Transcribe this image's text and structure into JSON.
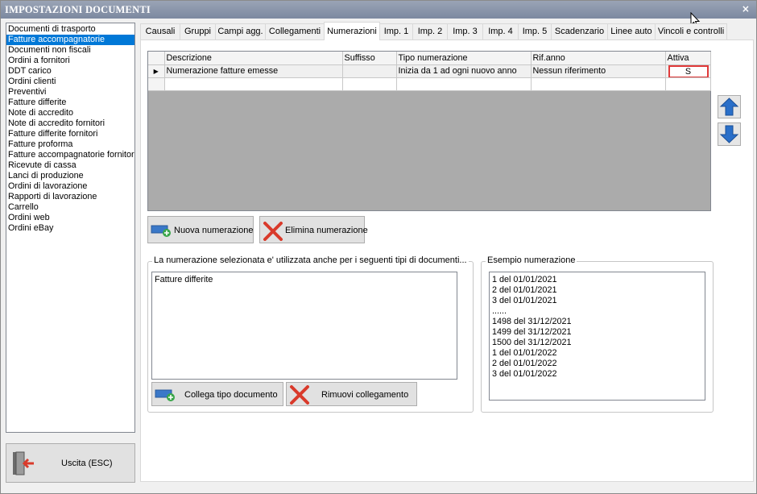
{
  "window": {
    "title": "IMPOSTAZIONI DOCUMENTI",
    "close_label": "×"
  },
  "doc_types": [
    {
      "label": "Documenti di trasporto",
      "selected": false
    },
    {
      "label": "Fatture accompagnatorie",
      "selected": true
    },
    {
      "label": "Documenti non fiscali",
      "selected": false
    },
    {
      "label": "Ordini a fornitori",
      "selected": false
    },
    {
      "label": "DDT carico",
      "selected": false
    },
    {
      "label": "Ordini clienti",
      "selected": false
    },
    {
      "label": "Preventivi",
      "selected": false
    },
    {
      "label": "Fatture differite",
      "selected": false
    },
    {
      "label": "Note di accredito",
      "selected": false
    },
    {
      "label": "Note di accredito fornitori",
      "selected": false
    },
    {
      "label": "Fatture differite fornitori",
      "selected": false
    },
    {
      "label": "Fatture proforma",
      "selected": false
    },
    {
      "label": "Fatture accompagnatorie fornitori",
      "selected": false
    },
    {
      "label": "Ricevute di cassa",
      "selected": false
    },
    {
      "label": "Lanci di produzione",
      "selected": false
    },
    {
      "label": "Ordini di lavorazione",
      "selected": false
    },
    {
      "label": "Rapporti di lavorazione",
      "selected": false
    },
    {
      "label": "Carrello",
      "selected": false
    },
    {
      "label": "Ordini web",
      "selected": false
    },
    {
      "label": "Ordini eBay",
      "selected": false
    }
  ],
  "exit_button": {
    "label": "Uscita (ESC)",
    "icon": "exit-door-icon"
  },
  "tabs": [
    {
      "label": "Causali",
      "active": false
    },
    {
      "label": "Gruppi",
      "active": false
    },
    {
      "label": "Campi agg.",
      "active": false
    },
    {
      "label": "Collegamenti",
      "active": false
    },
    {
      "label": "Numerazioni",
      "active": true
    },
    {
      "label": "Imp. 1",
      "active": false
    },
    {
      "label": "Imp. 2",
      "active": false
    },
    {
      "label": "Imp. 3",
      "active": false
    },
    {
      "label": "Imp. 4",
      "active": false
    },
    {
      "label": "Imp. 5",
      "active": false
    },
    {
      "label": "Scadenzario",
      "active": false
    },
    {
      "label": "Linee auto",
      "active": false
    },
    {
      "label": "Vincoli e controlli",
      "active": false
    }
  ],
  "grid": {
    "columns": [
      "Descrizione",
      "Suffisso",
      "Tipo numerazione",
      "Rif.anno",
      "Attiva"
    ],
    "rows": [
      {
        "descrizione": "Numerazione fatture emesse",
        "suffisso": "",
        "tipo": "Inizia da 1 ad ogni nuovo anno",
        "rif_anno": "Nessun riferimento",
        "attiva": "S"
      }
    ],
    "row_indicator": "▶"
  },
  "buttons": {
    "nuova": "Nuova numerazione",
    "elimina": "Elimina numerazione",
    "collega": "Collega tipo documento",
    "rimuovi": "Rimuovi collegamento"
  },
  "linked_docs": {
    "legend": "La numerazione selezionata e' utilizzata anche per i seguenti tipi di documenti...",
    "items": [
      "Fatture differite"
    ]
  },
  "example": {
    "legend": "Esempio numerazione",
    "lines": [
      "1 del 01/01/2021",
      "2 del 01/01/2021",
      "3 del 01/01/2021",
      "......",
      "1498 del 31/12/2021",
      "1499 del 31/12/2021",
      "1500 del 31/12/2021",
      "1 del 01/01/2022",
      "2 del 01/01/2022",
      "3 del 01/01/2022"
    ]
  },
  "colors": {
    "selection": "#0078d7",
    "highlight_border": "#e03a3a",
    "arrow_blue": "#2a6fc9"
  }
}
